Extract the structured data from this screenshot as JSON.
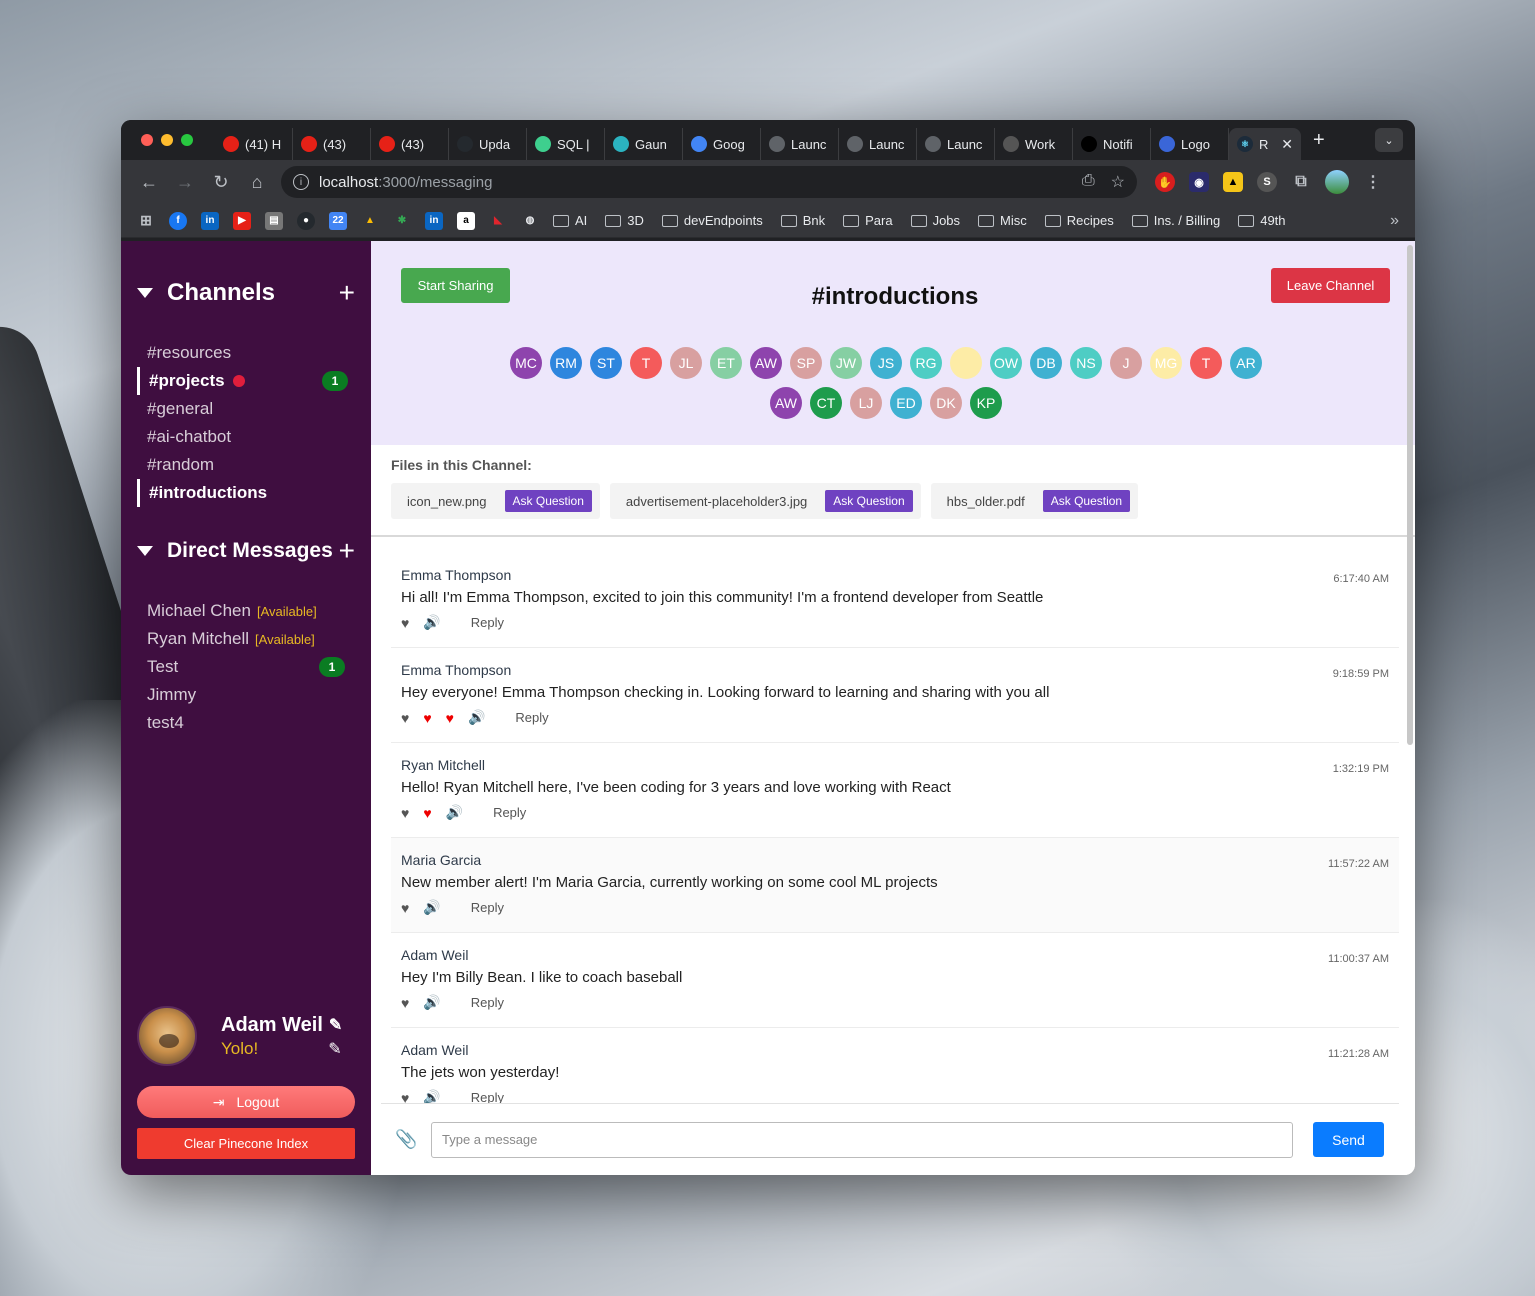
{
  "browser": {
    "tabs": [
      {
        "label": "(41) H",
        "icon": "youtube-icon",
        "color": "#e62117"
      },
      {
        "label": "(43) ",
        "icon": "youtube-icon",
        "color": "#e62117"
      },
      {
        "label": "(43) ",
        "icon": "youtube-icon",
        "color": "#e62117"
      },
      {
        "label": "Upda",
        "icon": "github-icon",
        "color": "#24292e"
      },
      {
        "label": "SQL |",
        "icon": "bolt-icon",
        "color": "#3ecf8e"
      },
      {
        "label": "Gaun",
        "icon": "app-icon",
        "color": "#2bb3c0"
      },
      {
        "label": "Goog",
        "icon": "calendar-icon",
        "color": "#4285f4"
      },
      {
        "label": "Launc",
        "icon": "globe-icon",
        "color": "#5f6368"
      },
      {
        "label": "Launc",
        "icon": "globe-icon",
        "color": "#5f6368"
      },
      {
        "label": "Launc",
        "icon": "globe-icon",
        "color": "#5f6368"
      },
      {
        "label": "Work",
        "icon": "w-icon",
        "color": "#555"
      },
      {
        "label": "Notifi",
        "icon": "x-icon",
        "color": "#000"
      },
      {
        "label": "Logo",
        "icon": "logo-icon",
        "color": "#3a66d8"
      }
    ],
    "active_tab": {
      "label": "R"
    },
    "url_host": "localhost",
    "url_path": ":3000/messaging",
    "bookmarks": [
      "AI",
      "3D",
      "devEndpoints",
      "Bnk",
      "Para",
      "Jobs",
      "Misc",
      "Recipes",
      "Ins. / Billing",
      "49th"
    ]
  },
  "sidebar": {
    "channels_title": "Channels",
    "channels": [
      {
        "name": "#resources",
        "bold": false
      },
      {
        "name": "#projects",
        "bold": true,
        "dot": true,
        "badge": "1"
      },
      {
        "name": "#general",
        "bold": false
      },
      {
        "name": "#ai-chatbot",
        "bold": false
      },
      {
        "name": "#random",
        "bold": false
      },
      {
        "name": "#introductions",
        "bold": true
      }
    ],
    "dm_title": "Direct Messages",
    "dms": [
      {
        "name": "Michael Chen",
        "status": "[Available]"
      },
      {
        "name": "Ryan Mitchell",
        "status": "[Available]"
      },
      {
        "name": "Test",
        "badge": "1"
      },
      {
        "name": "Jimmy"
      },
      {
        "name": "test4"
      }
    ],
    "profile_name": "Adam Weil",
    "profile_status": "Yolo!",
    "logout_label": "Logout",
    "clear_label": "Clear Pinecone Index"
  },
  "channel": {
    "title": "#introductions",
    "start_sharing": "Start Sharing",
    "leave_channel": "Leave Channel",
    "members": [
      {
        "initials": "MC",
        "color": "#8e44ad"
      },
      {
        "initials": "RM",
        "color": "#2e86de"
      },
      {
        "initials": "ST",
        "color": "#2e86de"
      },
      {
        "initials": "T",
        "color": "#f45b5b"
      },
      {
        "initials": "JL",
        "color": "#d8a0a0"
      },
      {
        "initials": "ET",
        "color": "#86cfa3"
      },
      {
        "initials": "AW",
        "color": "#8e44ad"
      },
      {
        "initials": "SP",
        "color": "#d8a0a0"
      },
      {
        "initials": "JW",
        "color": "#86cfa3"
      },
      {
        "initials": "JS",
        "color": "#3fb1d1"
      },
      {
        "initials": "RG",
        "color": "#4ecdc4"
      },
      {
        "initials": "",
        "color": "#fdeca6"
      },
      {
        "initials": "OW",
        "color": "#4ecdc4"
      },
      {
        "initials": "DB",
        "color": "#3fb1d1"
      },
      {
        "initials": "NS",
        "color": "#4ecdc4"
      },
      {
        "initials": "J",
        "color": "#d8a0a0"
      },
      {
        "initials": "MG",
        "color": "#fdeca6"
      },
      {
        "initials": "T",
        "color": "#f45b5b"
      },
      {
        "initials": "AR",
        "color": "#3fb1d1"
      },
      {
        "initials": "AW",
        "color": "#8e44ad"
      },
      {
        "initials": "CT",
        "color": "#1e9c4c"
      },
      {
        "initials": "LJ",
        "color": "#d8a0a0"
      },
      {
        "initials": "ED",
        "color": "#3fb1d1"
      },
      {
        "initials": "DK",
        "color": "#d8a0a0"
      },
      {
        "initials": "KP",
        "color": "#1e9c4c"
      }
    ],
    "files_title": "Files in this Channel:",
    "ask_label": "Ask Question",
    "files": [
      "icon_new.png",
      "advertisement-placeholder3.jpg",
      "hbs_older.pdf"
    ]
  },
  "messages": [
    {
      "author": "Emma Thompson",
      "time": "6:17:40 AM",
      "text": "Hi all! I'm Emma Thompson, excited to join this community! I'm a frontend developer from Seattle",
      "red_hearts": 0,
      "reply": "Reply"
    },
    {
      "author": "Emma Thompson",
      "time": "9:18:59 PM",
      "text": "Hey everyone! Emma Thompson checking in. Looking forward to learning and sharing with you all",
      "red_hearts": 2,
      "reply": "Reply"
    },
    {
      "author": "Ryan Mitchell",
      "time": "1:32:19 PM",
      "text": "Hello! Ryan Mitchell here, I've been coding for 3 years and love working with React",
      "red_hearts": 1,
      "reply": "Reply"
    },
    {
      "author": "Maria Garcia",
      "time": "11:57:22 AM",
      "text": "New member alert! I'm Maria Garcia, currently working on some cool ML projects",
      "red_hearts": 0,
      "reply": "Reply"
    },
    {
      "author": "Adam Weil",
      "time": "11:00:37 AM",
      "text": "Hey I'm Billy Bean. I like to coach baseball",
      "red_hearts": 0,
      "reply": "Reply"
    },
    {
      "author": "Adam Weil",
      "time": "11:21:28 AM",
      "text": "The jets won yesterday!",
      "red_hearts": 0,
      "reply": "Reply"
    }
  ],
  "composer": {
    "placeholder": "Type a message",
    "send_label": "Send"
  }
}
